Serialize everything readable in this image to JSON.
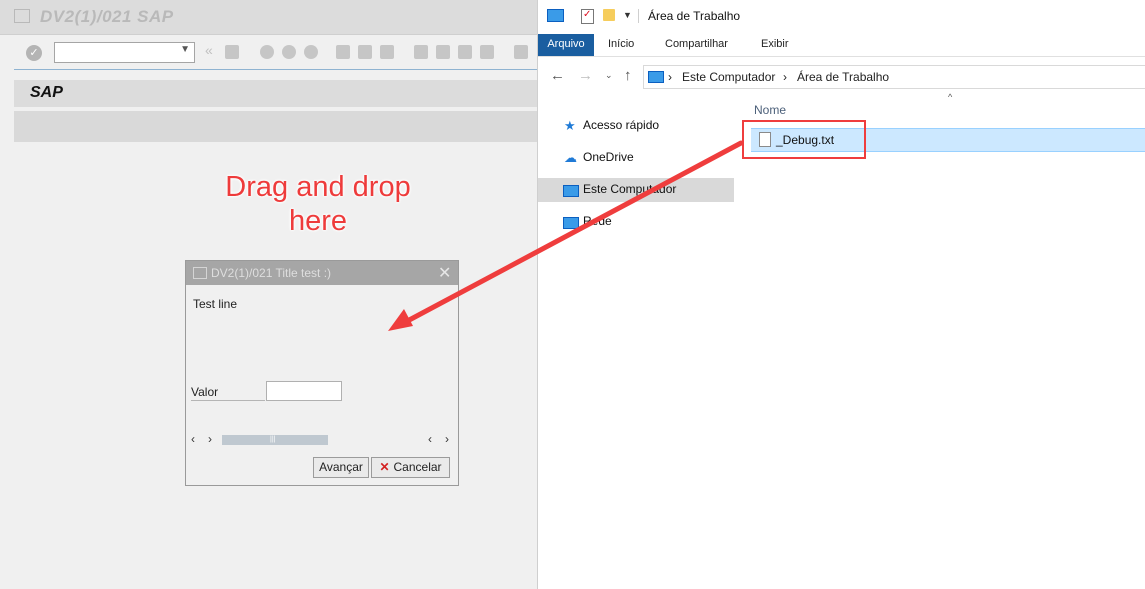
{
  "sap": {
    "window_title": "DV2(1)/021 SAP",
    "header_title": "SAP"
  },
  "annotation": {
    "text_line1": "Drag and drop",
    "text_line2": "here"
  },
  "dialog": {
    "title": "DV2(1)/021 Title test :)",
    "text_line": "Test line",
    "field_label": "Valor",
    "field_value": "",
    "next_button": "Avançar",
    "cancel_button": "Cancelar"
  },
  "explorer": {
    "title": "Área de Trabalho",
    "ribbon_tabs": [
      "Arquivo",
      "Início",
      "Compartilhar",
      "Exibir"
    ],
    "breadcrumb": [
      "Este Computador",
      "Área de Trabalho"
    ],
    "nav_items": [
      {
        "label": "Acesso rápido",
        "icon": "star-icon"
      },
      {
        "label": "OneDrive",
        "icon": "cloud-icon"
      },
      {
        "label": "Este Computador",
        "icon": "computer-icon",
        "selected": true
      },
      {
        "label": "Rede",
        "icon": "network-icon"
      }
    ],
    "column_header": "Nome",
    "files": [
      {
        "name": "_Debug.txt",
        "icon": "text-file-icon",
        "selected": true
      }
    ]
  },
  "colors": {
    "annotation_red": "#ef3d3d",
    "ribbon_blue": "#1a5ea0",
    "selection_blue": "#cce8ff"
  }
}
